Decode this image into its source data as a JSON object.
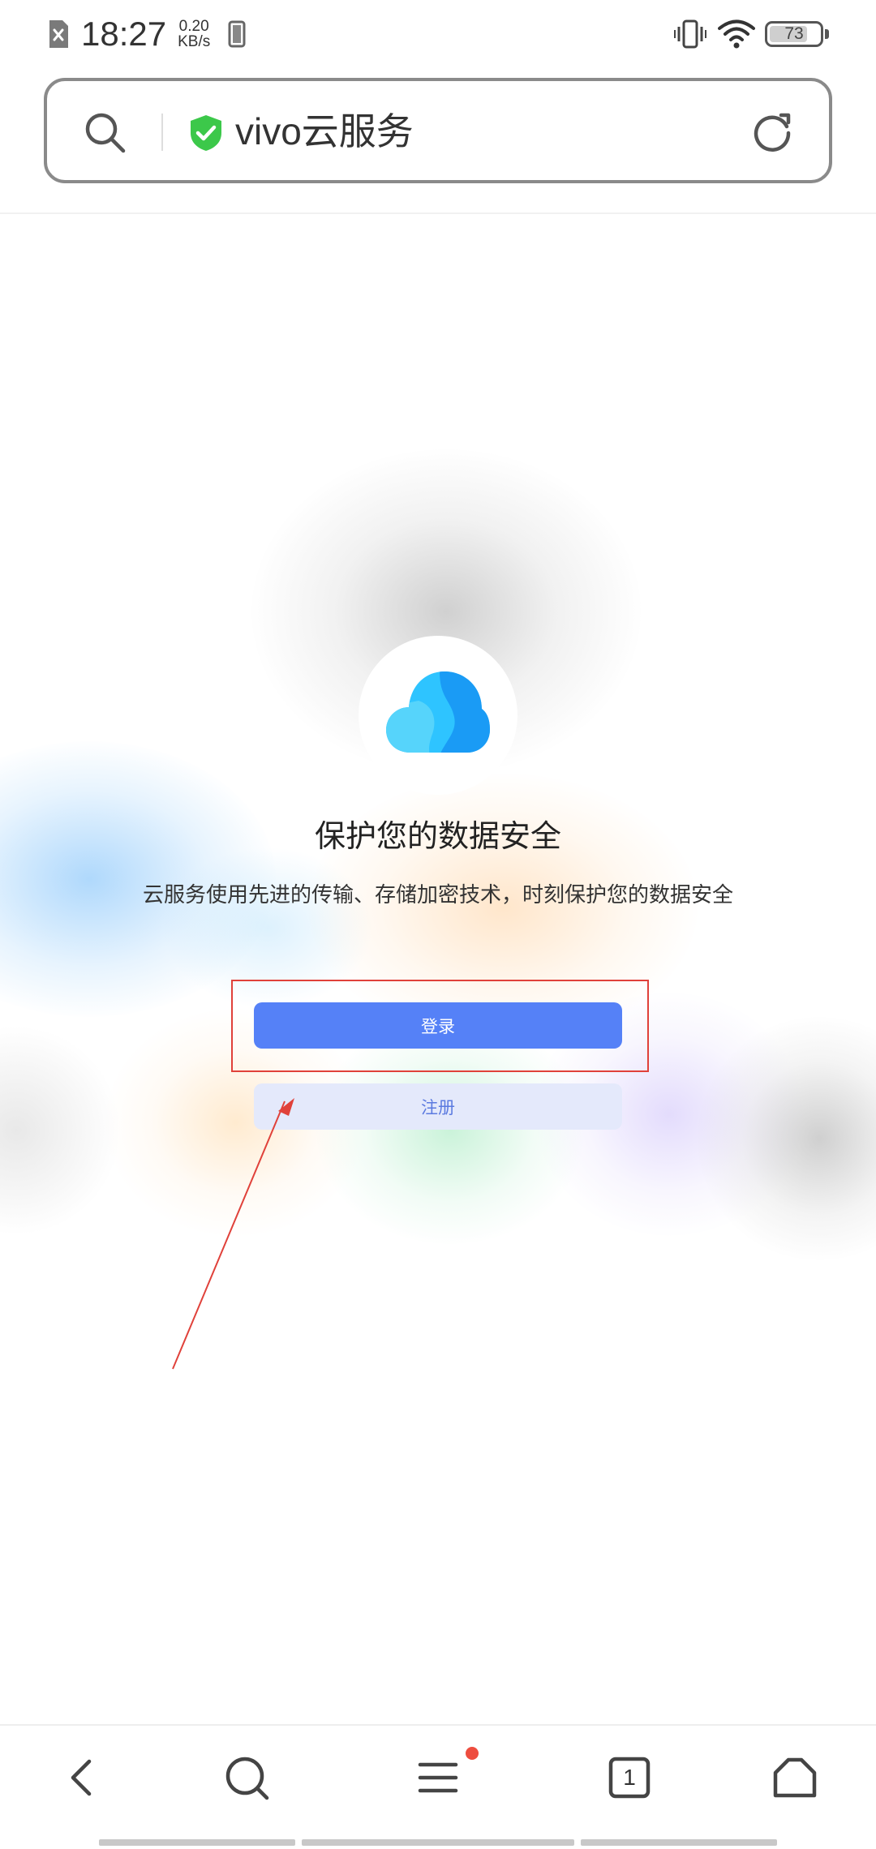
{
  "status_bar": {
    "time": "18:27",
    "net_speed_value": "0.20",
    "net_speed_unit": "KB/s",
    "battery_percent": "73",
    "icons": [
      "sim-off-icon",
      "phone-icon",
      "vibrate-icon",
      "wifi-icon",
      "battery-icon"
    ]
  },
  "address_bar": {
    "title": "vivo云服务",
    "icons": [
      "search-icon",
      "shield-check-icon",
      "refresh-icon"
    ],
    "shield_color": "#3cc84a"
  },
  "main": {
    "headline": "保护您的数据安全",
    "subline": "云服务使用先进的传输、存储加密技术，时刻保护您的数据安全",
    "login_label": "登录",
    "register_label": "注册",
    "cloud_colors": [
      "#2ec4ff",
      "#1a9bf5",
      "#56d4fb"
    ],
    "login_color": "#5581f7",
    "register_bg_color": "#e4e9fb",
    "annotation_color": "#e0413a"
  },
  "bottom_nav": {
    "items": [
      "back-icon",
      "search-icon",
      "menu-icon",
      "tabs-icon",
      "home-icon"
    ],
    "tab_count": "1",
    "notification_dot_color": "#ee4d3f"
  }
}
